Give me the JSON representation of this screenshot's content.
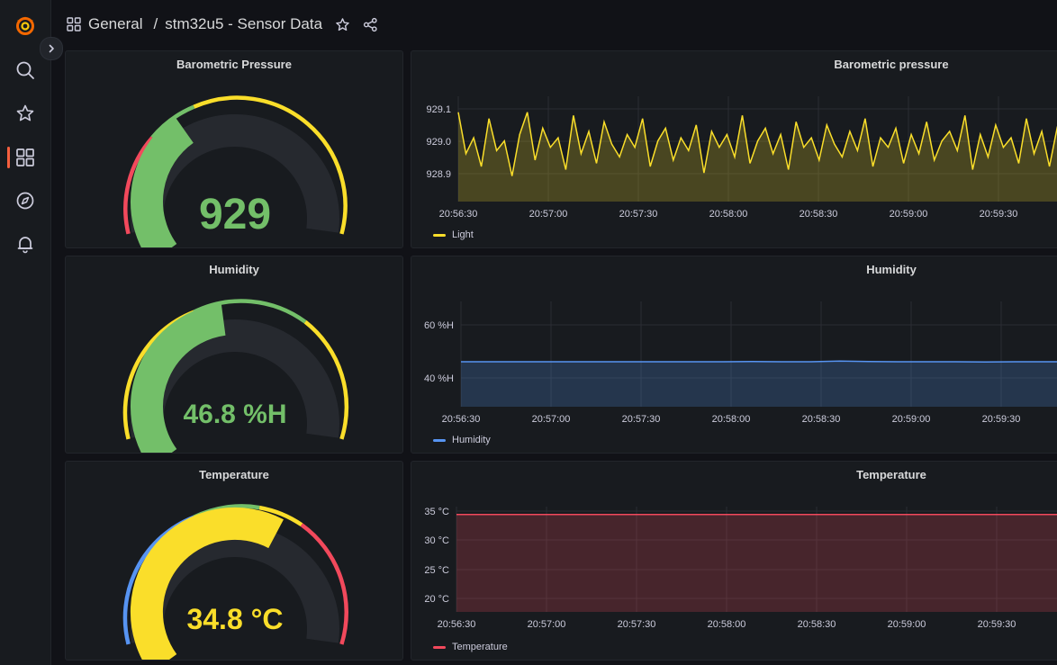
{
  "sidebar": {
    "items": [
      {
        "name": "grafana-logo-icon"
      },
      {
        "name": "search-icon"
      },
      {
        "name": "starred-icon"
      },
      {
        "name": "dashboards-icon"
      },
      {
        "name": "explore-icon"
      },
      {
        "name": "alerting-icon"
      }
    ],
    "active_color": "#f55f3e"
  },
  "header": {
    "folder": "General",
    "separator": "/",
    "title": "stm32u5 - Sensor Data"
  },
  "panels": {
    "pressure_gauge": {
      "title": "Barometric Pressure",
      "value_text": "929",
      "fraction": 0.36,
      "value_color": "#73bf69"
    },
    "humidity_gauge": {
      "title": "Humidity",
      "value_text": "46.8 %H",
      "fraction": 0.47,
      "value_color": "#73bf69"
    },
    "temperature_gauge": {
      "title": "Temperature",
      "value_text": "34.8 °C",
      "fraction": 0.61,
      "value_color": "#fade2a"
    },
    "pressure_chart": {
      "title": "Barometric pressure",
      "legend": "Light",
      "color": "#fade2a"
    },
    "humidity_chart": {
      "title": "Humidity",
      "legend": "Humidity",
      "color": "#5794f2"
    },
    "temperature_chart": {
      "title": "Temperature",
      "legend": "Temperature",
      "color": "#f2495c"
    }
  },
  "chart_data": [
    {
      "type": "area",
      "title": "Barometric pressure",
      "x_ticks": [
        "20:56:30",
        "20:57:00",
        "20:57:30",
        "20:58:00",
        "20:58:30",
        "20:59:00",
        "20:59:30"
      ],
      "y_ticks": [
        "929.1",
        "929.0",
        "928.9"
      ],
      "ylim": [
        928.82,
        929.15
      ],
      "series": [
        {
          "name": "Light",
          "color": "#fade2a",
          "values": [
            929.1,
            928.97,
            929.02,
            928.93,
            929.08,
            928.98,
            929.01,
            928.9,
            929.03,
            929.1,
            928.95,
            929.05,
            928.99,
            929.02,
            928.92,
            929.09,
            928.97,
            929.04,
            928.94,
            929.07,
            929.0,
            928.96,
            929.03,
            928.99,
            929.08,
            928.93,
            929.01,
            929.05,
            928.95,
            929.02,
            928.98,
            929.06,
            928.91,
            929.04,
            928.99,
            929.03,
            928.96,
            929.09,
            928.94,
            929.01,
            929.05,
            928.97,
            929.03,
            928.92,
            929.07,
            928.99,
            929.02,
            928.95,
            929.06,
            929.0,
            928.96,
            929.04,
            928.98,
            929.08,
            928.93,
            929.02,
            928.99,
            929.05,
            928.94,
            929.03,
            928.97,
            929.07,
            928.95,
            929.01,
            929.04,
            928.98,
            929.09,
            928.92,
            929.03,
            928.96,
            929.06,
            928.99,
            929.02,
            928.94,
            929.08,
            928.97,
            929.04,
            928.93,
            929.05,
            929.0,
            928.96,
            929.07,
            928.98,
            929.03,
            928.91,
            929.06,
            928.99,
            929.02,
            928.95,
            929.08,
            928.97,
            929.04,
            929.0,
            928.93,
            929.06,
            928.98,
            929.03,
            928.96,
            929.1,
            928.95,
            929.02,
            928.99,
            929.05,
            928.94,
            929.07,
            928.97,
            929.03,
            928.92,
            929.06,
            929.0,
            928.96,
            929.08,
            928.98,
            929.04,
            928.95,
            929.01,
            929.07,
            928.93,
            929.02,
            929.05,
            928.97,
            929.09,
            928.99,
            929.03,
            928.94,
            929.06,
            928.98,
            929.02,
            928.95,
            929.04
          ]
        }
      ]
    },
    {
      "type": "area",
      "title": "Humidity",
      "x_ticks": [
        "20:56:30",
        "20:57:00",
        "20:57:30",
        "20:58:00",
        "20:58:30",
        "20:59:00",
        "20:59:30"
      ],
      "y_ticks": [
        "60 %H",
        "40 %H"
      ],
      "ylim": [
        29.5,
        70
      ],
      "series": [
        {
          "name": "Humidity",
          "color": "#5794f2",
          "values": [
            46.8,
            46.8,
            46.8,
            46.8,
            46.8,
            46.8,
            46.8,
            46.8,
            46.8,
            46.8,
            46.9,
            46.8,
            46.8,
            47.1,
            46.9,
            46.8,
            46.8,
            46.8,
            46.7,
            46.8,
            46.8,
            46.8,
            46.8,
            46.8,
            46.8,
            46.8,
            46.8,
            46.9,
            46.8,
            46.8,
            46.8,
            46.8,
            46.8,
            46.8,
            46.8
          ]
        }
      ]
    },
    {
      "type": "area",
      "title": "Temperature",
      "x_ticks": [
        "20:56:30",
        "20:57:00",
        "20:57:30",
        "20:58:00",
        "20:58:30",
        "20:59:00",
        "20:59:30"
      ],
      "y_ticks": [
        "35 °C",
        "30 °C",
        "25 °C",
        "20 °C"
      ],
      "ylim": [
        17.5,
        36.2
      ],
      "series": [
        {
          "name": "Temperature",
          "color": "#f2495c",
          "values": [
            34.8,
            34.8,
            34.8,
            34.8,
            34.8,
            34.8,
            34.8,
            34.8,
            34.8,
            34.8,
            34.8,
            34.8,
            34.8,
            34.8,
            34.8,
            34.8,
            34.8,
            34.8,
            34.8,
            34.8,
            34.8,
            34.8,
            34.8,
            34.8,
            34.8
          ]
        }
      ]
    }
  ]
}
